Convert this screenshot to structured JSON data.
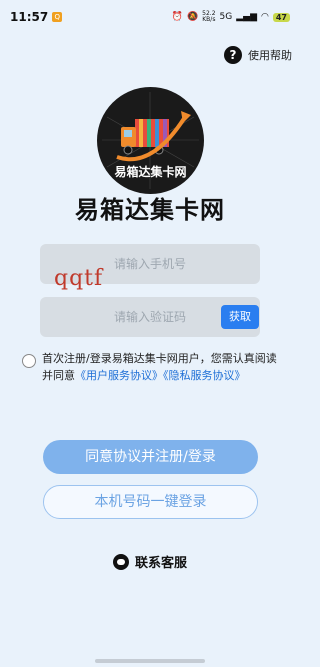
{
  "status_bar": {
    "time": "11:57",
    "app_badge": "Q",
    "net_speed_top": "52.2",
    "net_speed_bottom": "KB/s",
    "network": "5G",
    "battery": "47"
  },
  "help": {
    "icon": "?",
    "label": "使用帮助"
  },
  "logo": {
    "text": "易箱达集卡网"
  },
  "app_title": "易箱达集卡网",
  "form": {
    "phone_placeholder": "请输入手机号",
    "code_placeholder": "请输入验证码",
    "get_code_label": "获取",
    "watermark": "qqtf"
  },
  "agreement": {
    "text": "首次注册/登录易箱达集卡网用户，您需认真阅读并同意",
    "user_agreement": "《用户服务协议》",
    "privacy_agreement": "《隐私服务协议》"
  },
  "buttons": {
    "agree_login": "同意协议并注册/登录",
    "one_click_login": "本机号码一键登录"
  },
  "service": {
    "label": "联系客服"
  },
  "colors": {
    "background": "#e9f2fb",
    "primary_button": "#7fb2ec",
    "link": "#1e6fd6",
    "get_code_button": "#2a7ef0"
  }
}
